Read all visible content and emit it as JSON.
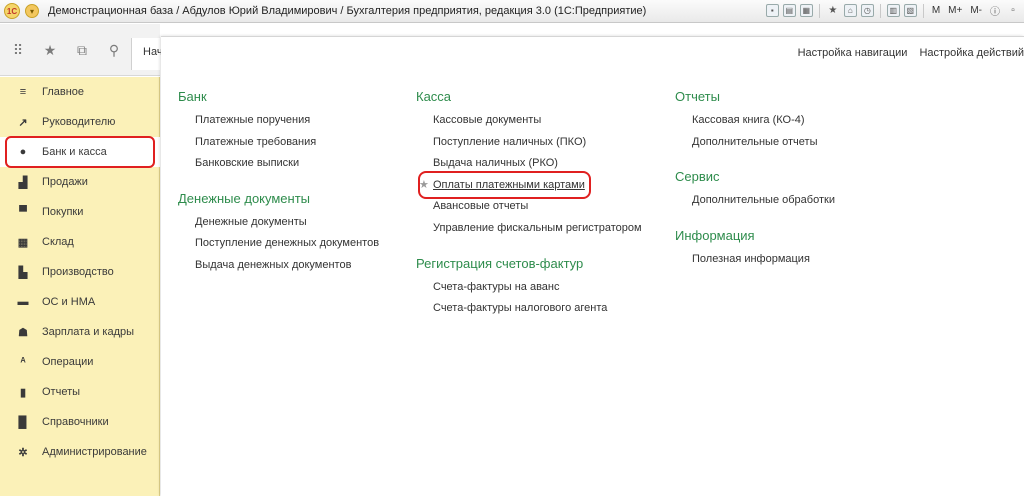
{
  "window": {
    "title": "Демонстрационная база / Абдулов Юрий Владимирович / Бухгалтерия предприятия, редакция 3.0  (1С:Предприятие)",
    "logo_text": "1С",
    "tools": [
      "M",
      "M+",
      "M-"
    ]
  },
  "tab": {
    "label": "Нач"
  },
  "nav_links": [
    "Настройка навигации",
    "Настройка действий"
  ],
  "sidebar": {
    "items": [
      {
        "label": "Главное",
        "icon": "menu-lines-icon"
      },
      {
        "label": "Руководителю",
        "icon": "trend-chart-icon"
      },
      {
        "label": "Банк и касса",
        "icon": "coin-icon"
      },
      {
        "label": "Продажи",
        "icon": "shopping-bag-icon"
      },
      {
        "label": "Покупки",
        "icon": "cart-icon"
      },
      {
        "label": "Склад",
        "icon": "warehouse-grid-icon"
      },
      {
        "label": "Производство",
        "icon": "factory-icon"
      },
      {
        "label": "ОС и НМА",
        "icon": "truck-icon"
      },
      {
        "label": "Зарплата и кадры",
        "icon": "person-icon"
      },
      {
        "label": "Операции",
        "icon": "operations-icon"
      },
      {
        "label": "Отчеты",
        "icon": "bar-chart-icon"
      },
      {
        "label": "Справочники",
        "icon": "book-icon"
      },
      {
        "label": "Администрирование",
        "icon": "gear-icon"
      }
    ]
  },
  "columns": {
    "col1": {
      "groups": [
        {
          "title": "Банк",
          "links": [
            "Платежные поручения",
            "Платежные требования",
            "Банковские выписки"
          ]
        },
        {
          "title": "Денежные документы",
          "links": [
            "Денежные документы",
            "Поступление денежных документов",
            "Выдача денежных документов"
          ]
        }
      ]
    },
    "col2": {
      "groups": [
        {
          "title": "Касса",
          "links": [
            "Кассовые документы",
            "Поступление наличных (ПКО)",
            "Выдача наличных (РКО)",
            "Оплаты платежными картами",
            "Авансовые отчеты",
            "Управление фискальным регистратором"
          ]
        },
        {
          "title": "Регистрация счетов-фактур",
          "links": [
            "Счета-фактуры на аванс",
            "Счета-фактуры налогового агента"
          ]
        }
      ]
    },
    "col3": {
      "groups": [
        {
          "title": "Отчеты",
          "links": [
            "Кассовая книга (КО-4)",
            "Дополнительные отчеты"
          ]
        },
        {
          "title": "Сервис",
          "links": [
            "Дополнительные обработки"
          ]
        },
        {
          "title": "Информация",
          "links": [
            "Полезная информация"
          ]
        }
      ]
    }
  }
}
